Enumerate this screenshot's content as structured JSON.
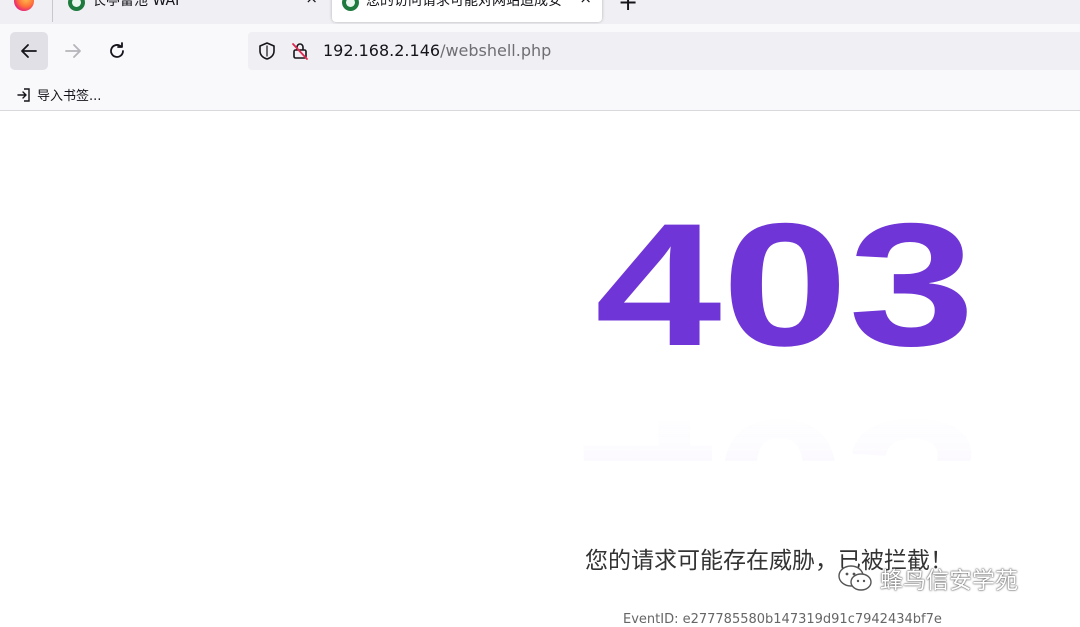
{
  "browser": {
    "tabs": [
      {
        "title": "长亭雷池 WAF",
        "active": false
      },
      {
        "title": "您的访问请求可能对网站造成安",
        "active": true
      }
    ],
    "close_glyph": "×",
    "new_tab_glyph": "+",
    "url": {
      "host": "192.168.2.146",
      "path": "/webshell.php"
    },
    "bookmarks": {
      "import_label": "导入书签..."
    }
  },
  "page": {
    "code": "403",
    "message": "您的请求可能存在威胁，已被拦截！",
    "event_id": "EventID: e277785580b147319d91c7942434bf7e"
  },
  "watermark": {
    "text": "蜂鸟信安学苑"
  },
  "colors": {
    "accent": "#6f35d6",
    "accent_light": "#9b6bf0"
  }
}
